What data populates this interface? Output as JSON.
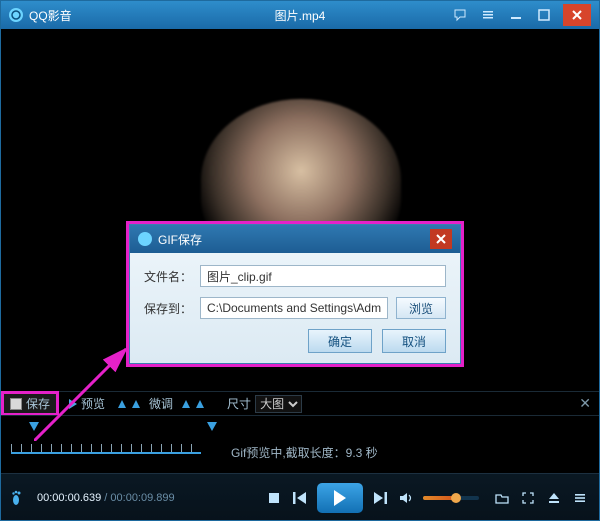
{
  "titlebar": {
    "app_name": "QQ影音",
    "file_name": "图片.mp4"
  },
  "dialog": {
    "title": "GIF保存",
    "filename_label": "文件名：",
    "filename_value": "图片_clip.gif",
    "saveto_label": "保存到：",
    "saveto_value": "C:\\Documents and Settings\\Admir",
    "browse_label": "浏览",
    "ok_label": "确定",
    "cancel_label": "取消"
  },
  "toolstrip": {
    "save_label": "保存",
    "preview_label": "预览",
    "finetune_label": "微调",
    "size_label": "尺寸",
    "size_value": "大图"
  },
  "timeline": {
    "status_text": "Gif预览中,截取长度：9.3 秒"
  },
  "playerbar": {
    "time_current": "00:00:00.639",
    "time_separator": " / ",
    "time_duration": "00:00:09.899"
  }
}
